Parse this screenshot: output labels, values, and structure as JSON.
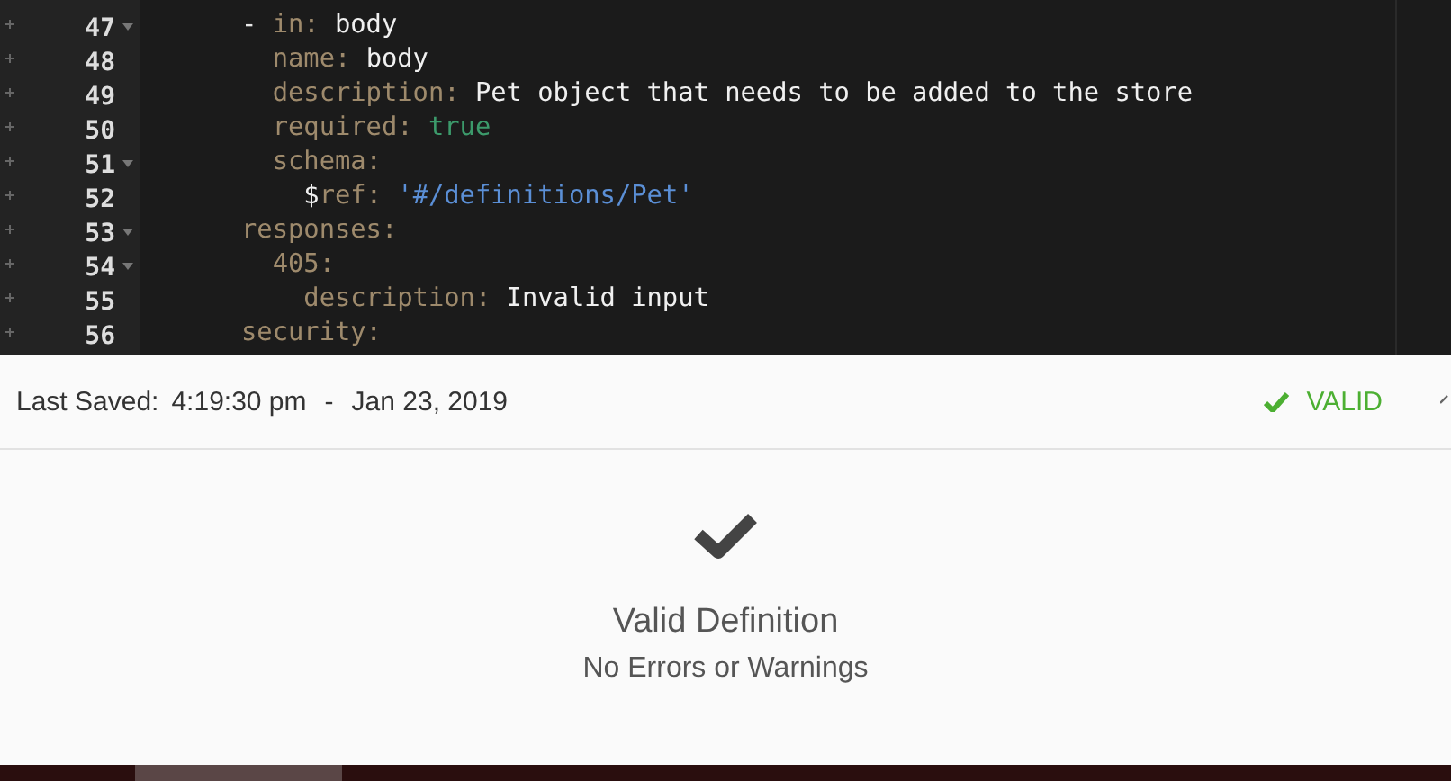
{
  "editor": {
    "lines": [
      {
        "number": "47",
        "foldable": true,
        "tokens": [
          {
            "kind": "punct",
            "text": "- "
          },
          {
            "kind": "key",
            "text": "in: "
          },
          {
            "kind": "value",
            "text": "body"
          }
        ]
      },
      {
        "number": "48",
        "foldable": false,
        "tokens": [
          {
            "kind": "key",
            "text": "  name: "
          },
          {
            "kind": "value",
            "text": "body"
          }
        ]
      },
      {
        "number": "49",
        "foldable": false,
        "tokens": [
          {
            "kind": "key",
            "text": "  description: "
          },
          {
            "kind": "value",
            "text": "Pet object that needs to be added to the store"
          }
        ]
      },
      {
        "number": "50",
        "foldable": false,
        "tokens": [
          {
            "kind": "key",
            "text": "  required: "
          },
          {
            "kind": "boolean",
            "text": "true"
          }
        ]
      },
      {
        "number": "51",
        "foldable": true,
        "tokens": [
          {
            "kind": "key",
            "text": "  schema:"
          }
        ]
      },
      {
        "number": "52",
        "foldable": false,
        "tokens": [
          {
            "kind": "value",
            "text": "    $"
          },
          {
            "kind": "key",
            "text": "ref: "
          },
          {
            "kind": "string",
            "text": "'#/definitions/Pet'"
          }
        ]
      },
      {
        "number": "53",
        "foldable": true,
        "tokens": [
          {
            "kind": "key",
            "text": "responses:"
          }
        ]
      },
      {
        "number": "54",
        "foldable": true,
        "tokens": [
          {
            "kind": "key",
            "text": "  405:"
          }
        ]
      },
      {
        "number": "55",
        "foldable": false,
        "tokens": [
          {
            "kind": "key",
            "text": "    description: "
          },
          {
            "kind": "value",
            "text": "Invalid input"
          }
        ]
      },
      {
        "number": "56",
        "foldable": false,
        "tokens": [
          {
            "kind": "key",
            "text": "security:"
          }
        ]
      }
    ]
  },
  "status": {
    "last_saved_label": "Last Saved:",
    "time": "4:19:30 pm",
    "separator": "-",
    "date": "Jan 23, 2019",
    "validity": "VALID",
    "valid": true
  },
  "result": {
    "title": "Valid Definition",
    "subtitle": "No Errors or Warnings"
  }
}
